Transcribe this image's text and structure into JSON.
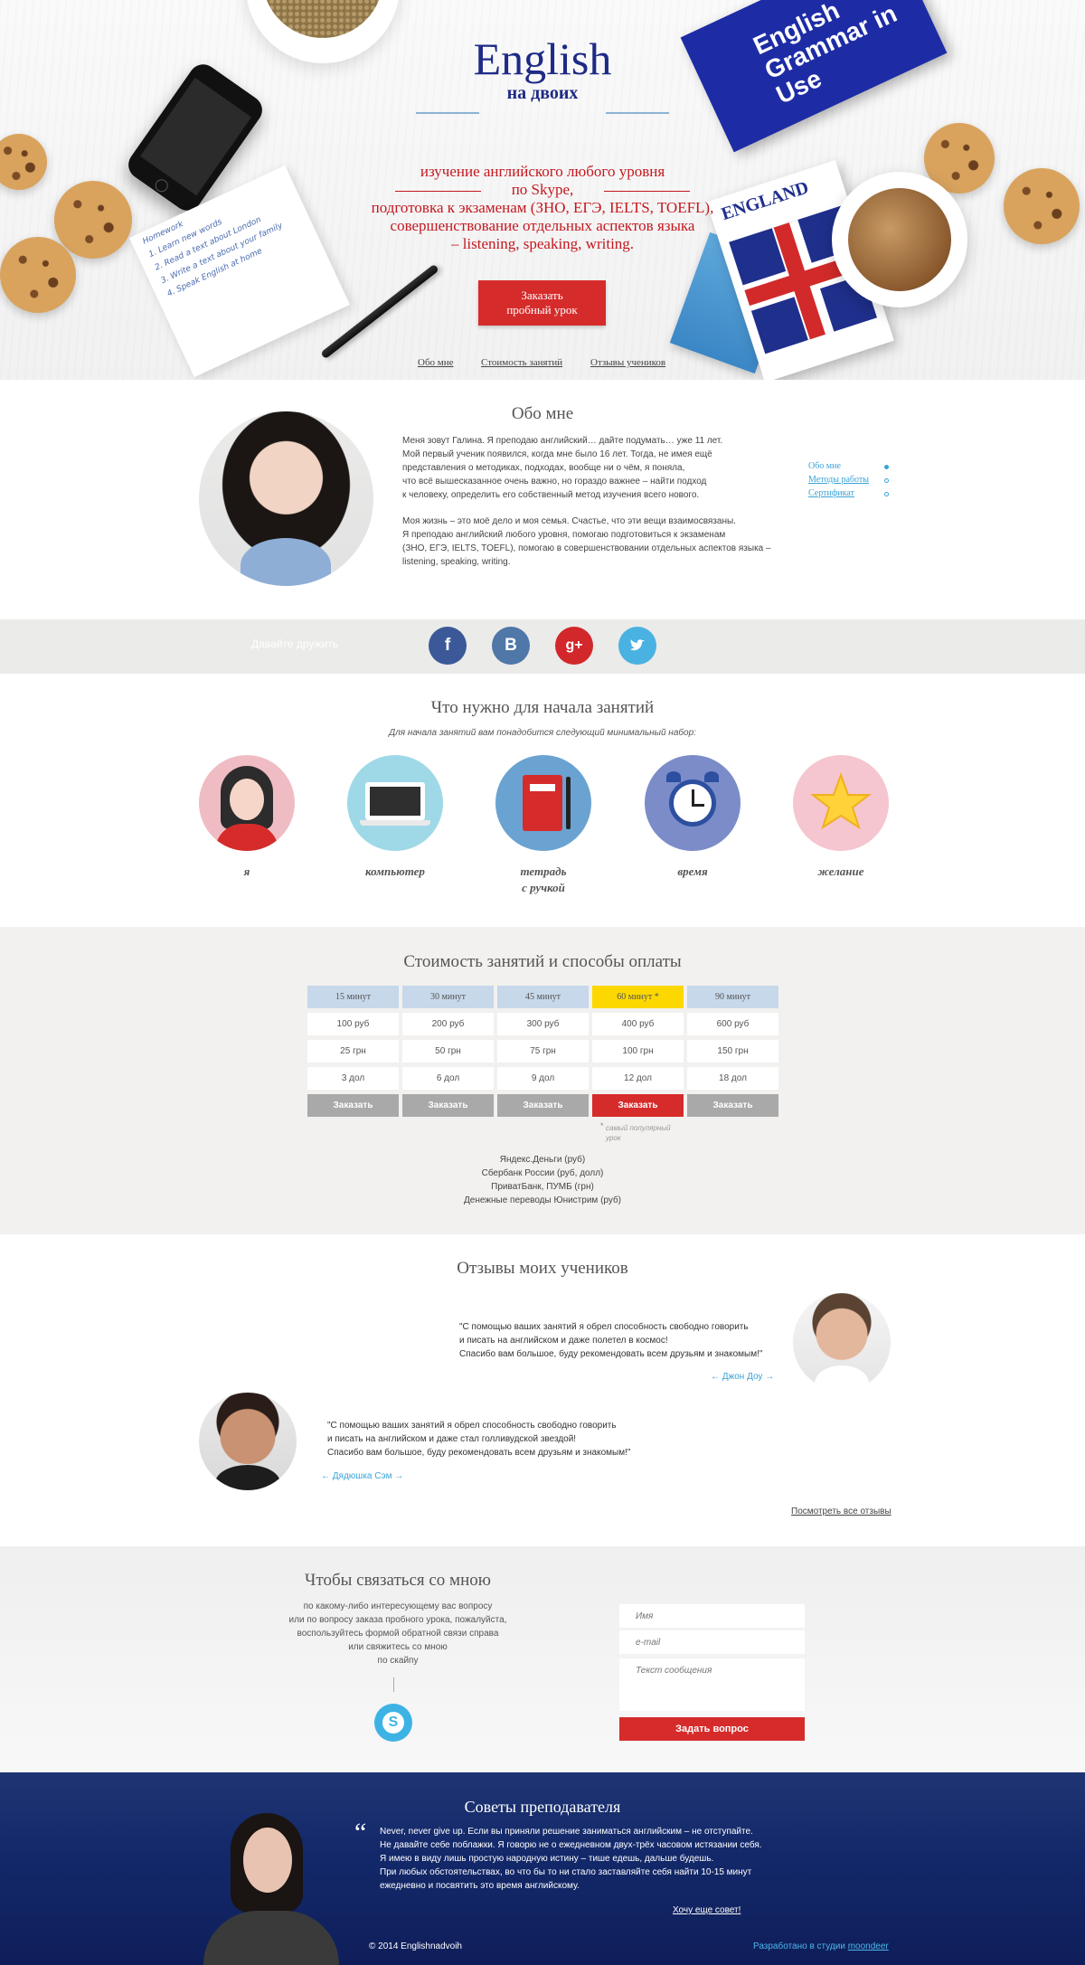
{
  "hero": {
    "logo_main": "English",
    "logo_sub": "на двоих",
    "book_title": "English Grammar in Use",
    "england_book": "ENGLAND",
    "notebook_lines": [
      "Homework",
      "1. Learn new words",
      "2. Read a text about London",
      "3. Write a text about your family",
      "4. Speak English at home"
    ],
    "tagline": [
      "изучение английского любого уровня",
      "по Skype,",
      "подготовка к экзаменам (ЗНО, ЕГЭ, IELTS, TOEFL),",
      "совершенствование отдельных аспектов языка",
      "– listening, speaking, writing."
    ],
    "cta_line1": "Заказать",
    "cta_line2": "пробный урок",
    "nav": [
      "Обо мне",
      "Стоимость занятий",
      "Отзывы учеников"
    ]
  },
  "about": {
    "title": "Обо мне",
    "paragraph1": [
      "Меня зовут Галина. Я преподаю английский… дайте подумать… уже 11 лет.",
      "Мой первый ученик появился, когда мне было 16 лет. Тогда, не имея ещё",
      "представления о методиках, подходах, вообще ни о чём, я поняла,",
      "что всё вышесказанное очень важно, но гораздо важнее – найти подход",
      "к человеку, определить его собственный метод изучения всего нового."
    ],
    "paragraph2": [
      "Моя жизнь – это моё дело и моя семья. Счастье, что эти вещи взаимосвязаны.",
      "Я преподаю английский любого уровня, помогаю подготовиться к экзаменам",
      "(ЗНО, ЕГЭ, IELTS, TOEFL), помогаю в совершенствовании отдельных аспектов языка –",
      "listening, speaking, writing."
    ],
    "side_nav": [
      "Обо мне",
      "Методы работы",
      "Сертификат"
    ]
  },
  "social": {
    "label": "Давайте дружить",
    "icons": [
      "f",
      "В",
      "g+",
      "t"
    ]
  },
  "need": {
    "title": "Что нужно для начала занятий",
    "subtitle": "Для начала занятий вам понадобится следующий минимальный набор:",
    "items": [
      "я",
      "компьютер",
      "тетрадь",
      "с ручкой",
      "время",
      "желание"
    ]
  },
  "prices": {
    "title": "Стоимость занятий и способы оплаты",
    "headers": [
      "15 минут",
      "30 минут",
      "45 минут",
      "60 минут *",
      "90 минут"
    ],
    "rows": [
      [
        "100 руб",
        "200 руб",
        "300 руб",
        "400 руб",
        "600 руб"
      ],
      [
        "25 грн",
        "50 грн",
        "75 грн",
        "100 грн",
        "150 грн"
      ],
      [
        "3 дол",
        "6 дол",
        "9 дол",
        "12 дол",
        "18 дол"
      ]
    ],
    "order_label": "Заказать",
    "footnote_mark": "*",
    "footnote": [
      "самый популярный",
      "урок"
    ],
    "payments": [
      "Яндекс.Деньги (руб)",
      "Сбербанк России (руб, долл)",
      "ПриватБанк, ПУМБ (грн)",
      "Денежные переводы Юнистрим (руб)"
    ]
  },
  "reviews": {
    "title": "Отзывы моих учеников",
    "r1": [
      "\"С помощью ваших занятий я обрел способность свободно говорить",
      "и писать на английском и даже полетел в космос!",
      "Спасибо вам большое, буду рекомендовать всем друзьям и знакомым!\""
    ],
    "r1_author": "← Джон Доу →",
    "r2": [
      "\"С помощью ваших занятий я обрел способность свободно говорить",
      "и писать на английском и даже стал голливудской звездой!",
      "Спасибо вам большое, буду рекомендовать всем друзьям и знакомым!\""
    ],
    "r2_author": "← Дядюшка Сэм →",
    "all_link": "Посмотреть все отзывы"
  },
  "contact": {
    "title": "Чтобы связаться со мною",
    "text": [
      "по какому-либо интересующему вас вопросу",
      "или по вопросу заказа пробного урока, пожалуйста,",
      "воспользуйтесь формой обратной связи справа",
      "или свяжитесь со мною",
      "по скайпу"
    ],
    "name_placeholder": "Имя",
    "email_placeholder": "e-mail",
    "message_placeholder": "Текст сообщения",
    "submit": "Задать вопрос"
  },
  "footer": {
    "title": "Советы преподавателя",
    "quote": [
      "Never, never give up. Если вы приняли решение заниматься английским – не отступайте.",
      "Не давайте себе поблажки. Я говорю не о ежедневном двух-трёх часовом истязании себя.",
      "Я имею в виду лишь простую народную истину – тише едешь, дальше будешь.",
      "При любых обстоятельствах, во что бы то ни стало заставляйте себя найти 10-15 минут",
      "ежедневно и посвятить это время английскому."
    ],
    "more_link": "Хочу еще совет!",
    "copyright": "© 2014 Englishnadvoih",
    "dev_prefix": "Разработано в студии",
    "dev_studio": "moondeer"
  },
  "colors": {
    "accent_red": "#d62b2b",
    "brand_navy": "#1e2a86",
    "link_blue": "#3aa3d8",
    "highlight_yellow": "#fcd800",
    "table_header_blue": "#c6d8ea"
  }
}
